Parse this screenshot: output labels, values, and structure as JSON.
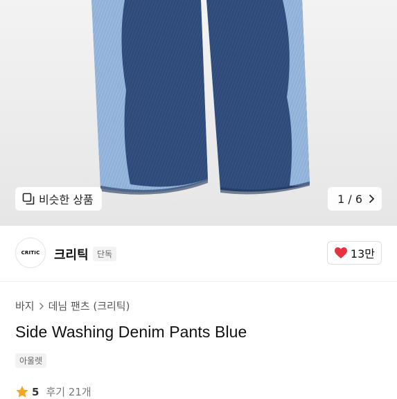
{
  "gallery": {
    "similar_label": "비슷한 상품",
    "similar_icon": "similar-items-icon",
    "counter": "1 / 6",
    "next_icon": "chevron-right-icon"
  },
  "brand": {
    "logo_text": "CRITIC",
    "name": "크리틱",
    "badge": "단독",
    "like_icon": "heart-icon",
    "like_count": "13만",
    "accent_color": "#e8313f"
  },
  "breadcrumb": {
    "category": "바지",
    "subcategory": "데님 팬츠 (크리틱)",
    "separator_icon": "chevron-right-icon"
  },
  "product": {
    "title": "Side Washing Denim Pants Blue",
    "tag": "아울렛"
  },
  "rating": {
    "star_icon": "star-icon",
    "star_color": "#f5a623",
    "score": "5",
    "reviews": "후기 21개"
  }
}
